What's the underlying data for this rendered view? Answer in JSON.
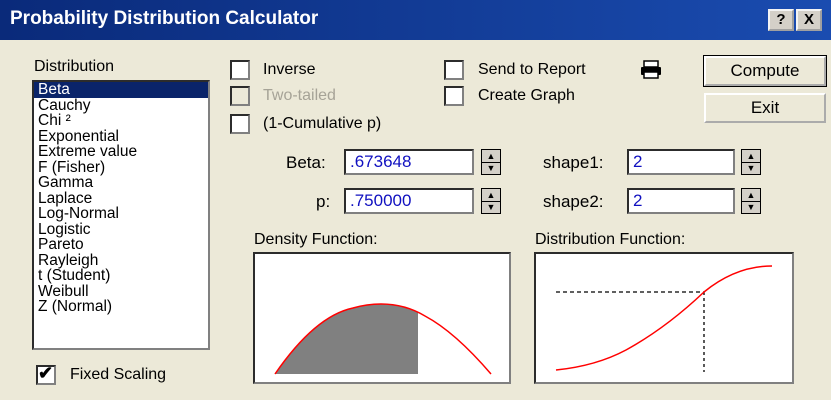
{
  "window": {
    "title": "Probability Distribution Calculator",
    "help_btn": "?",
    "close_btn": "X"
  },
  "distribution": {
    "label": "Distribution",
    "items": [
      "Beta",
      "Cauchy",
      "Chi ²",
      "Exponential",
      "Extreme value",
      "F (Fisher)",
      "Gamma",
      "Laplace",
      "Log-Normal",
      "Logistic",
      "Pareto",
      "Rayleigh",
      "t (Student)",
      "Weibull",
      "Z (Normal)"
    ],
    "selected": "Beta"
  },
  "options": {
    "inverse": "Inverse",
    "two_tailed": "Two-tailed",
    "one_minus_cumulative": "(1-Cumulative p)",
    "send_to_report": "Send to Report",
    "create_graph": "Create Graph",
    "fixed_scaling": "Fixed Scaling",
    "fixed_scaling_checked": true
  },
  "buttons": {
    "compute": "Compute",
    "exit": "Exit"
  },
  "params": {
    "beta_label": "Beta:",
    "beta_value": ".673648",
    "p_label": "p:",
    "p_value": ".750000",
    "shape1_label": "shape1:",
    "shape1_value": "2",
    "shape2_label": "shape2:",
    "shape2_value": "2"
  },
  "graphs": {
    "density_title": "Density Function:",
    "distribution_title": "Distribution Function:",
    "curve_color": "#ff0000",
    "fill_color": "#808080"
  }
}
